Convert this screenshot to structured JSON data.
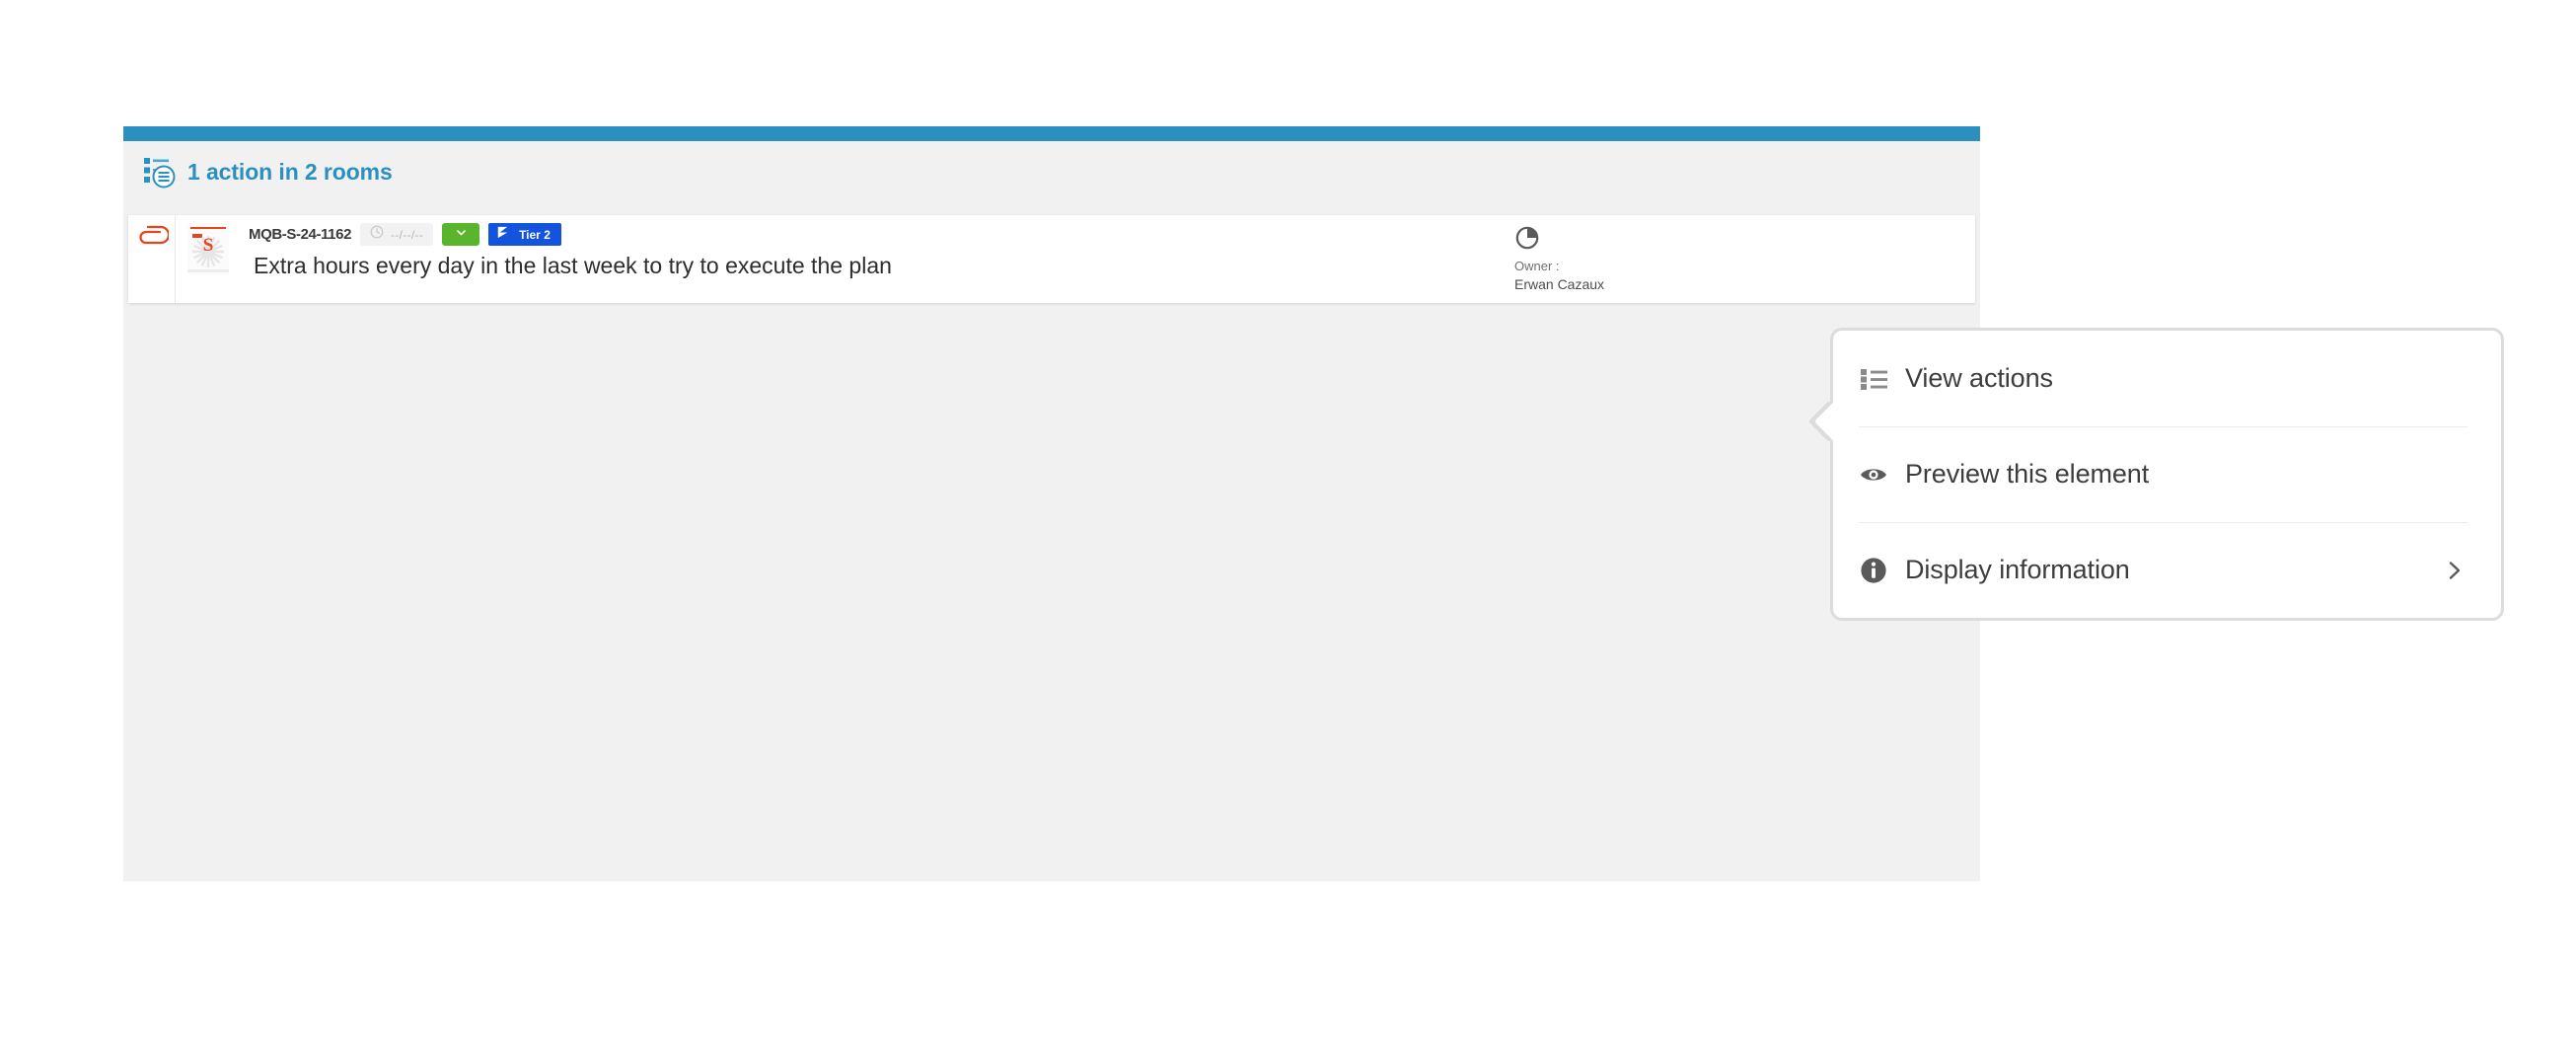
{
  "panel": {
    "header": {
      "icon": "list-document-icon",
      "title": "1 action in 2 rooms"
    },
    "accent_color": "#2b90c0",
    "background_color": "#f1f1f1"
  },
  "row": {
    "attachment_icon": "paperclip-icon",
    "thumbnail": {
      "icon": "document-thumbnail",
      "letter": "S"
    },
    "reference": "MQB-S-24-1162",
    "date_badge": {
      "icon": "clock-icon",
      "value": "--/--/--",
      "background": "#f2f2f2"
    },
    "status_badge": {
      "icon": "chevron-down-icon",
      "color": "#59b52c"
    },
    "tier_badge": {
      "icon": "tier-icon",
      "label": "Tier 2",
      "color": "#1353dd"
    },
    "title": "Extra hours every day in the last week to try to execute the plan",
    "owner": {
      "icon": "pie-chart-icon",
      "label": "Owner :",
      "name": "Erwan Cazaux"
    }
  },
  "popup": {
    "items": [
      {
        "icon": "list-icon",
        "label": "View actions",
        "has_submenu": false
      },
      {
        "icon": "eye-icon",
        "label": "Preview this element",
        "has_submenu": false
      },
      {
        "icon": "info-icon",
        "label": "Display information",
        "has_submenu": true
      }
    ],
    "submenu_icon": "chevron-right-icon"
  }
}
